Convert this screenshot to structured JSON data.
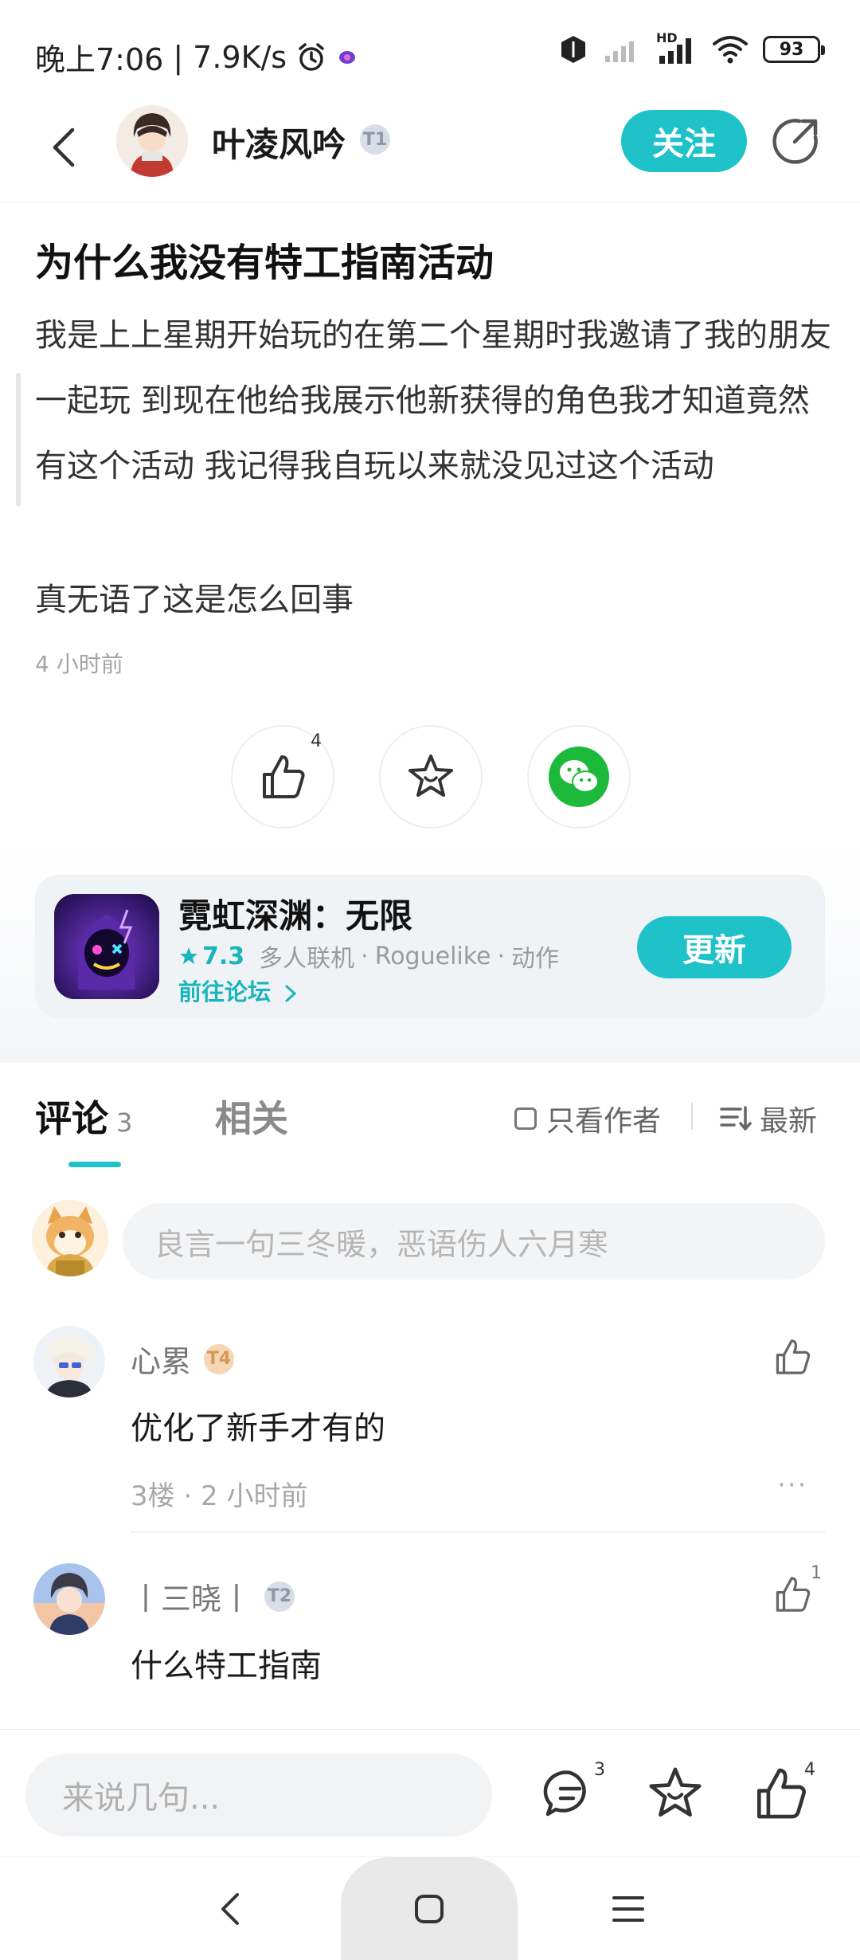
{
  "status_bar": {
    "time": "晚上7:06",
    "separator": "|",
    "net_speed": "7.9K/s",
    "hd_label": "HD",
    "battery": "93"
  },
  "header": {
    "author_name": "叶凌风吟",
    "author_level": "T1",
    "follow_label": "关注"
  },
  "post": {
    "title": "为什么我没有特工指南活动",
    "paragraph1": "我是上上星期开始玩的在第二个星期时我邀请了我的朋友一起玩 到现在他给我展示他新获得的角色我才知道竟然有这个活动 我记得我自玩以来就没见过这个活动",
    "paragraph2": "真无语了这是怎么回事",
    "time": "4 小时前",
    "like_count": "4"
  },
  "game": {
    "title": "霓虹深渊：无限",
    "rating": "7.3",
    "tags": [
      "多人联机",
      "Roguelike",
      "动作"
    ],
    "tag_sep": "·",
    "forum_link": "前往论坛",
    "update_label": "更新"
  },
  "tabs": {
    "comments_label": "评论",
    "comments_count": "3",
    "related_label": "相关",
    "author_only_label": "只看作者",
    "sort_label": "最新"
  },
  "comment_input": {
    "placeholder": "良言一句三冬暖，恶语伤人六月寒"
  },
  "comments": [
    {
      "name": "心累",
      "level": "T4",
      "text": "优化了新手才有的",
      "meta": "3楼 · 2 小时前",
      "more": "···",
      "likes": ""
    },
    {
      "name": "丨三晓丨",
      "level": "T2",
      "text": "什么特工指南",
      "likes": "1"
    }
  ],
  "bottom_bar": {
    "placeholder": "来说几句...",
    "comment_count": "3",
    "like_count": "4"
  },
  "colors": {
    "accent": "#1ec2c8",
    "wechat": "#1db93b",
    "level_silver": "#d9dde6",
    "level_gold": "#f5d7b5"
  }
}
